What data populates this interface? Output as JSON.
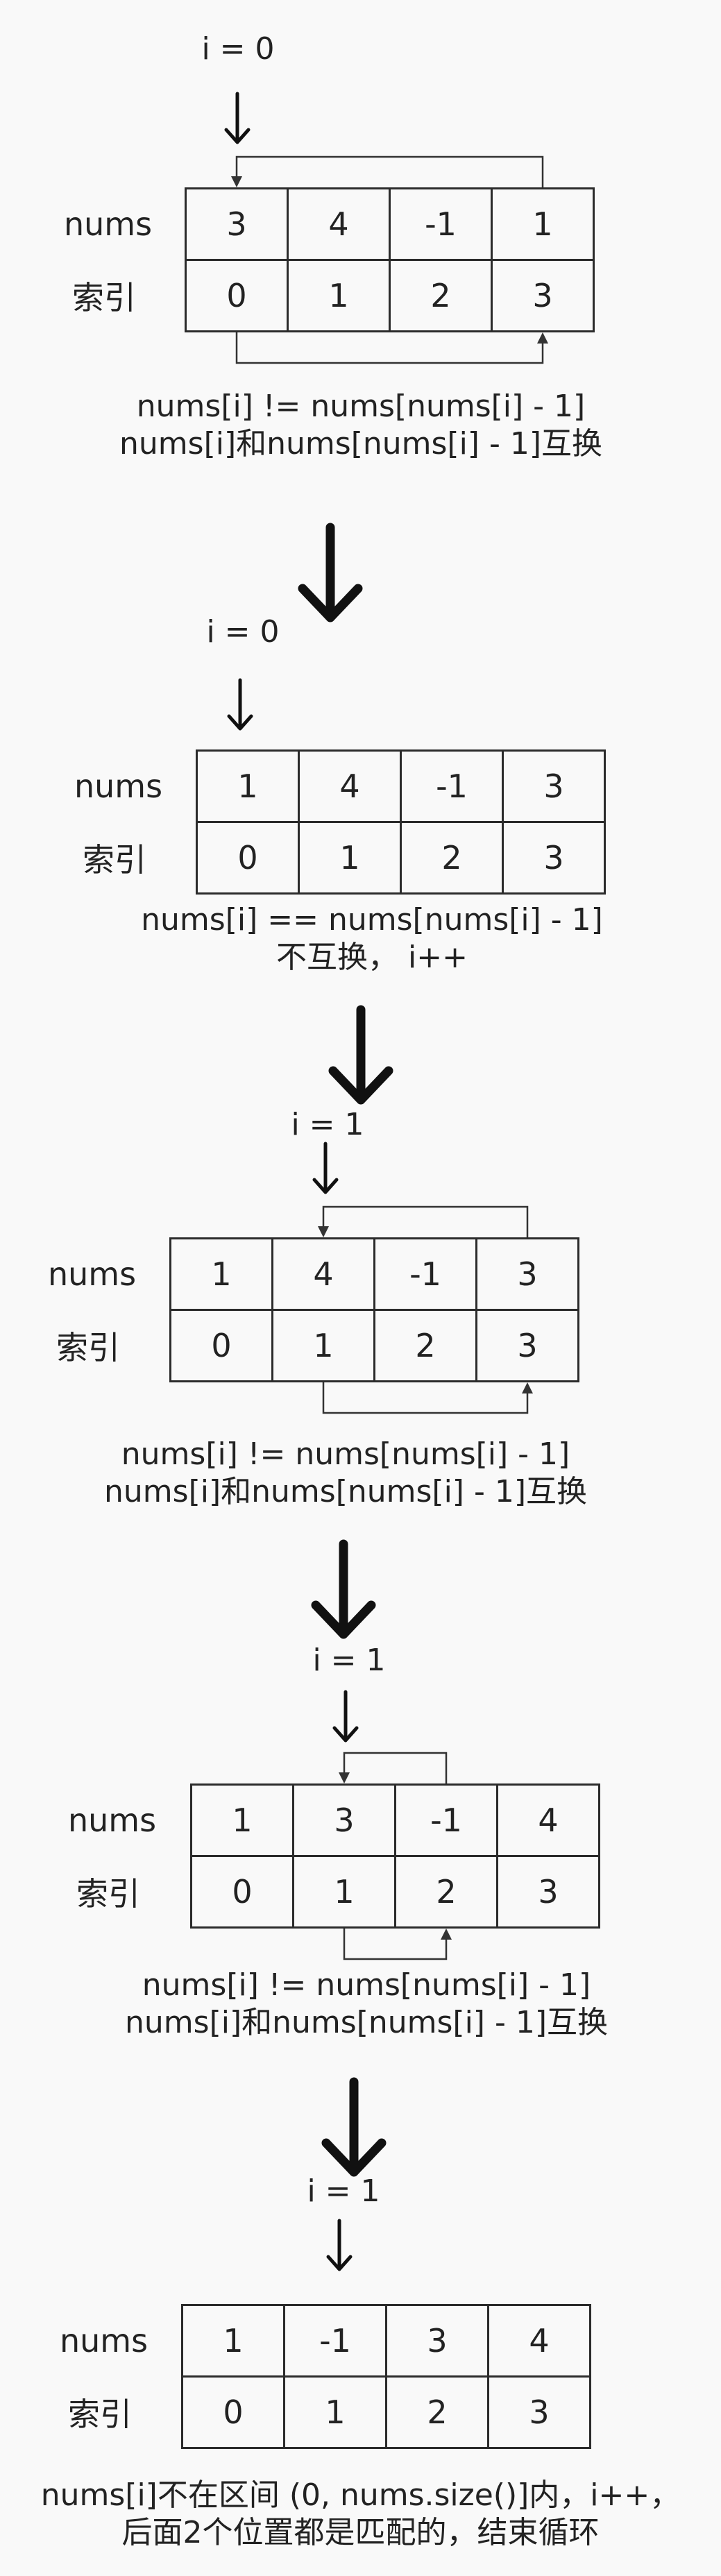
{
  "row_labels": {
    "nums": "nums",
    "index": "索引"
  },
  "steps": [
    {
      "pointer": "i = 0",
      "nums": [
        "3",
        "4",
        "-1",
        "1"
      ],
      "indices": [
        "0",
        "1",
        "2",
        "3"
      ],
      "note_line1": "nums[i] != nums[nums[i] - 1]",
      "note_line2": "nums[i]和nums[nums[i] - 1]互换"
    },
    {
      "pointer": "i = 0",
      "nums": [
        "1",
        "4",
        "-1",
        "3"
      ],
      "indices": [
        "0",
        "1",
        "2",
        "3"
      ],
      "note_line1": "nums[i] == nums[nums[i] - 1]",
      "note_line2": "不互换， i++"
    },
    {
      "pointer": "i = 1",
      "nums": [
        "1",
        "4",
        "-1",
        "3"
      ],
      "indices": [
        "0",
        "1",
        "2",
        "3"
      ],
      "note_line1": "nums[i] != nums[nums[i] - 1]",
      "note_line2": "nums[i]和nums[nums[i] - 1]互换"
    },
    {
      "pointer": "i = 1",
      "nums": [
        "1",
        "3",
        "-1",
        "4"
      ],
      "indices": [
        "0",
        "1",
        "2",
        "3"
      ],
      "note_line1": "nums[i] != nums[nums[i] - 1]",
      "note_line2": "nums[i]和nums[nums[i] - 1]互换"
    },
    {
      "pointer": "i = 1",
      "nums": [
        "1",
        "-1",
        "3",
        "4"
      ],
      "indices": [
        "0",
        "1",
        "2",
        "3"
      ],
      "note_line1": "nums[i]不在区间 (0, nums.size()]内，i++，",
      "note_line2": "后面2个位置都是匹配的，结束循环"
    }
  ]
}
